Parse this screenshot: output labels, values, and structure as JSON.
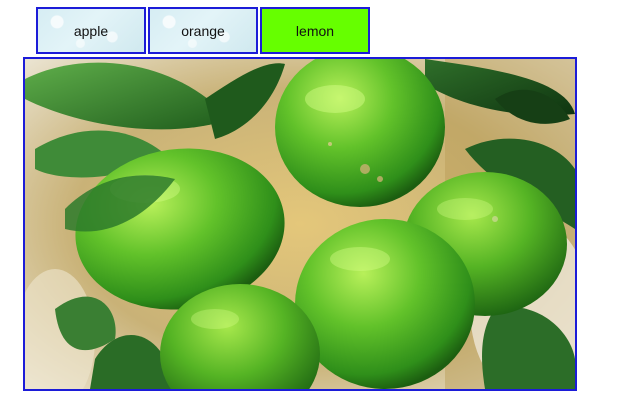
{
  "tabs": [
    {
      "label": "apple",
      "active": false
    },
    {
      "label": "orange",
      "active": false
    },
    {
      "label": "lemon",
      "active": true
    }
  ],
  "colors": {
    "border": "#1c1cd8",
    "active_tab": "#66ff00",
    "inactive_tab": "#d6edf3"
  },
  "panel": {
    "image": "lime-cluster-photo"
  }
}
